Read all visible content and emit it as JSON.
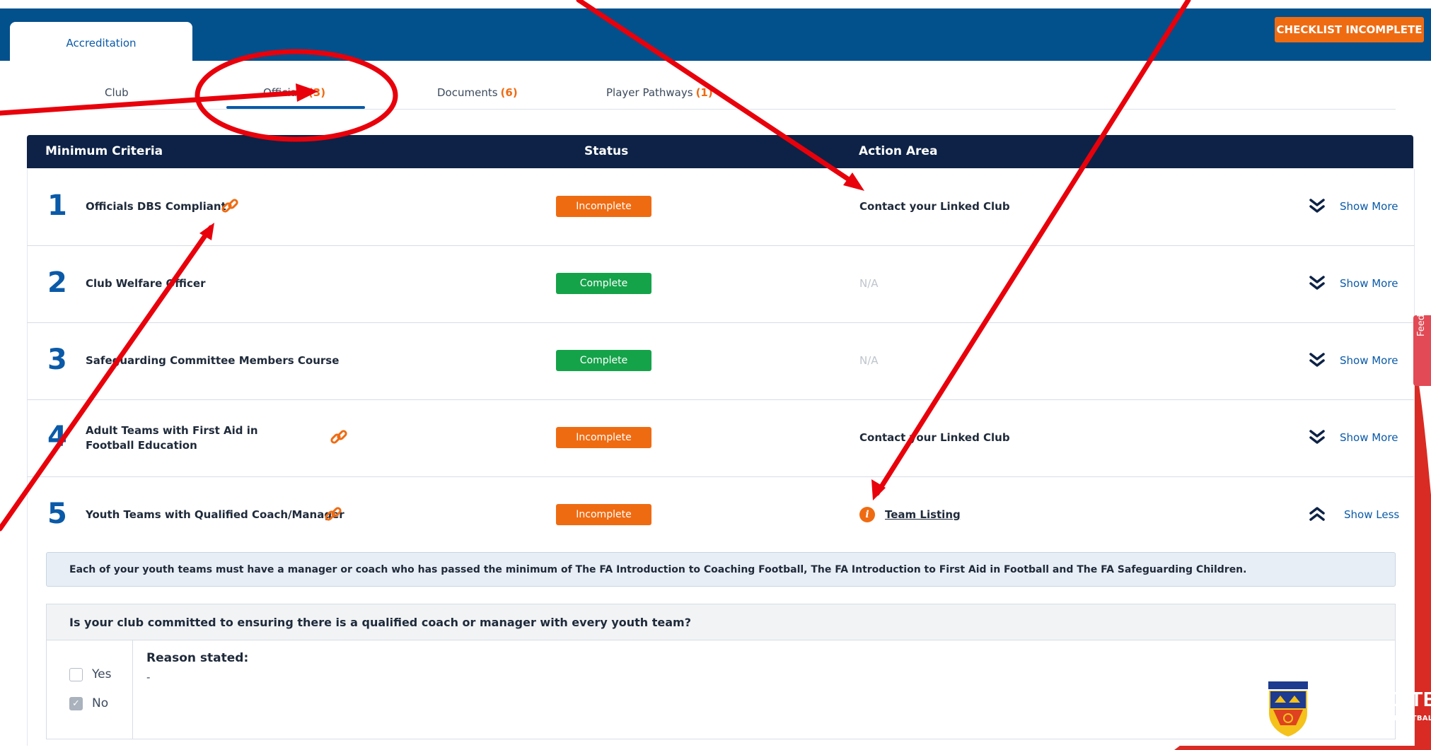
{
  "header": {
    "tab_label": "Accreditation",
    "checklist_badge": "CHECKLIST INCOMPLETE"
  },
  "subtabs": [
    {
      "label": "Club",
      "count": ""
    },
    {
      "label": "Officials",
      "count": "(3)"
    },
    {
      "label": "Documents",
      "count": "(6)"
    },
    {
      "label": "Player Pathways",
      "count": "(1)"
    }
  ],
  "table": {
    "columns": [
      "Minimum Criteria",
      "Status",
      "Action Area"
    ],
    "rows": [
      {
        "num": "1",
        "criteria": "Officials DBS Compliant",
        "status": "Incomplete",
        "action": "Contact your Linked Club",
        "toggle": "Show More"
      },
      {
        "num": "2",
        "criteria": "Club Welfare Officer",
        "status": "Complete",
        "action": "N/A",
        "toggle": "Show More"
      },
      {
        "num": "3",
        "criteria": "Safeguarding Committee Members Course",
        "status": "Complete",
        "action": "N/A",
        "toggle": "Show More"
      },
      {
        "num": "4",
        "criteria": "Adult Teams with First Aid in Football Education",
        "status": "Incomplete",
        "action": "Contact your Linked Club",
        "toggle": "Show More"
      },
      {
        "num": "5",
        "criteria": "Youth Teams with Qualified Coach/Manager",
        "status": "Incomplete",
        "action": "Team Listing",
        "toggle": "Show Less"
      }
    ]
  },
  "expanded": {
    "description": "Each of your youth teams must have a manager or coach who has passed the minimum of The FA Introduction to Coaching Football, The FA Introduction to First Aid in Football and The FA Safeguarding Children.",
    "question": "Is your club committed to ensuring there is a qualified coach or manager with every youth team?",
    "options": [
      {
        "label": "Yes",
        "checked": false
      },
      {
        "label": "No",
        "checked": true
      }
    ],
    "reason_label": "Reason stated:",
    "reason_value": "-"
  },
  "feedback_tab": "Feedback",
  "badge": {
    "title": "ACCREDITED",
    "subtitle": "PART OF ENGLAND FOOTBALL",
    "crest_label": "Staffordshire FA"
  },
  "colors": {
    "header_blue": "#02508c",
    "table_head_navy": "#0d2246",
    "incomplete_orange": "#ef6b12",
    "complete_green": "#15a34a",
    "accent_blue": "#0a5aa8",
    "annotation_red": "#e8000b",
    "corner_red": "#d92b23"
  }
}
